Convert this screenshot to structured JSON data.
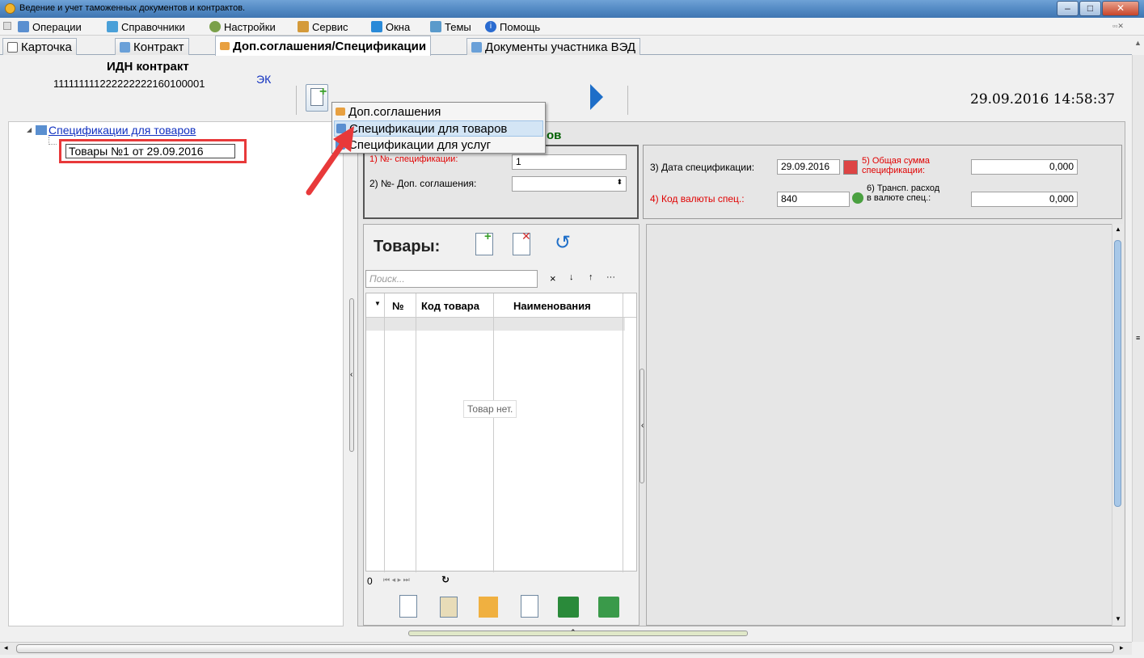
{
  "window": {
    "title": "Ведение и учет таможенных документов и контрактов."
  },
  "menu": [
    {
      "label": "Операции",
      "icon": "operations-icon"
    },
    {
      "label": "Справочники",
      "icon": "books-icon"
    },
    {
      "label": "Настройки",
      "icon": "gear-icon"
    },
    {
      "label": "Сервис",
      "icon": "user-icon"
    },
    {
      "label": "Окна",
      "icon": "windows-icon"
    },
    {
      "label": "Темы",
      "icon": "image-icon"
    },
    {
      "label": "Помощь",
      "icon": "info-icon"
    }
  ],
  "tabs": [
    {
      "label": "Карточка",
      "icon": "card-icon"
    },
    {
      "label": "Контракт",
      "icon": "contract-icon"
    },
    {
      "label": "Доп.соглашения/Спецификации",
      "icon": "spec-icon",
      "active": true
    },
    {
      "label": "Документы участника ВЭД",
      "icon": "docs-icon"
    }
  ],
  "header": {
    "idn_label": "ИДН контракт",
    "idn_value": "111111111222222222160100001",
    "ek_label": "ЭК",
    "datetime": "29.09.2016 14:58:37"
  },
  "tree": {
    "root": "Спецификации для товаров",
    "child": "Товары №1 от 29.09.2016"
  },
  "dropdown": {
    "items": [
      {
        "label": "Доп.соглашения"
      },
      {
        "label": "Спецификации для товаров",
        "selected": true
      },
      {
        "label": "Спецификации для услуг"
      }
    ]
  },
  "spec": {
    "group_title_tail": "ов",
    "f1_label": "1) №- спецификации:",
    "f1_value": "1",
    "f2_label": "2) №- Доп. соглашения:",
    "f3_label": "3) Дата спецификации:",
    "f3_value": "29.09.2016",
    "f4_label": "4) Код валюты спец.:",
    "f4_value": "840",
    "f5_label_1": "5) Общая сумма",
    "f5_label_2": "спецификации:",
    "f5_value": "0,000",
    "f6_label_1": "6) Трансп. расход",
    "f6_label_2": "в валюте спец.:",
    "f6_value": "0,000"
  },
  "goods": {
    "title": "Товары:",
    "search_placeholder": "Поиск...",
    "col_no": "№",
    "col_code": "Код товара",
    "col_name": "Наименования",
    "empty": "Товар нет.",
    "count": "0",
    "search_clear": "×",
    "search_down": "↓",
    "search_up": "↑",
    "search_more": "···"
  },
  "colors": {
    "accent": "#3f75b1",
    "red": "#e00000",
    "green_header": "#006000"
  }
}
